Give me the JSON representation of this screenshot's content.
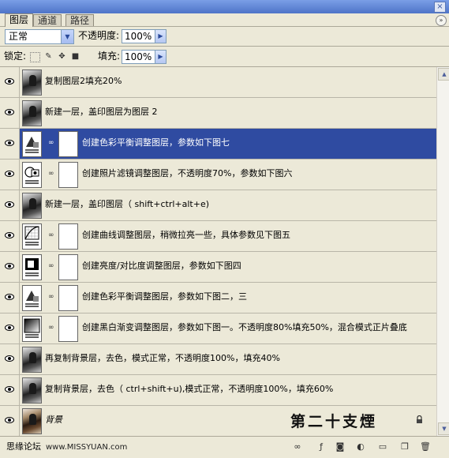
{
  "tabs": [
    {
      "label": "图层",
      "active": true
    },
    {
      "label": "通道",
      "active": false
    },
    {
      "label": "路径",
      "active": false
    }
  ],
  "title_close": "×",
  "panel_menu": "»",
  "blend_mode": {
    "value": "正常",
    "arrow": "▼"
  },
  "opacity": {
    "label": "不透明度:",
    "value": "100%",
    "arrow": "▶"
  },
  "lock": {
    "label": "锁定:"
  },
  "fill": {
    "label": "填充:",
    "value": "100%",
    "arrow": "▶"
  },
  "layers": [
    {
      "name": "复制图层2填充20%",
      "type": "photo",
      "selected": false
    },
    {
      "name": "新建一层，盖印图层为图层 2",
      "type": "photo",
      "selected": false
    },
    {
      "name": "创建色彩平衡调整图层，参数如下图七",
      "type": "color-balance",
      "selected": true
    },
    {
      "name": "创建照片滤镜调整图层，不透明度70%，参数如下图六",
      "type": "photo-filter",
      "selected": false
    },
    {
      "name": "新建一层，盖印图层（ shift+ctrl+alt+e)",
      "type": "photo",
      "selected": false
    },
    {
      "name": "创建曲线调整图层，稍微拉亮一些，具体参数见下图五",
      "type": "curves",
      "selected": false
    },
    {
      "name": "创建亮度/对比度调整图层，参数如下图四",
      "type": "brightness",
      "selected": false
    },
    {
      "name": "创建色彩平衡调整图层，参数如下图二，三",
      "type": "color-balance",
      "selected": false
    },
    {
      "name": "创建黑白渐变调整图层，参数如下图一。不透明度80%填充50%，混合模式正片叠底",
      "type": "gradient-map",
      "selected": false
    },
    {
      "name": "再复制背景层，去色，模式正常，不透明度100%，填充40%",
      "type": "photo",
      "selected": false
    },
    {
      "name": "复制背景层，去色（ ctrl+shift+u),模式正常，不透明度100%，填充60%",
      "type": "photo",
      "selected": false
    },
    {
      "name": "背景",
      "type": "background",
      "selected": false
    }
  ],
  "signature": "第二十支煙",
  "watermark": {
    "site": "思缘论坛",
    "url": "www.MISSYUAN.com"
  },
  "colors": {
    "selection": "#2f4ba1",
    "panel_bg": "#ece9d8",
    "titlebar": "#5a7fd6"
  }
}
